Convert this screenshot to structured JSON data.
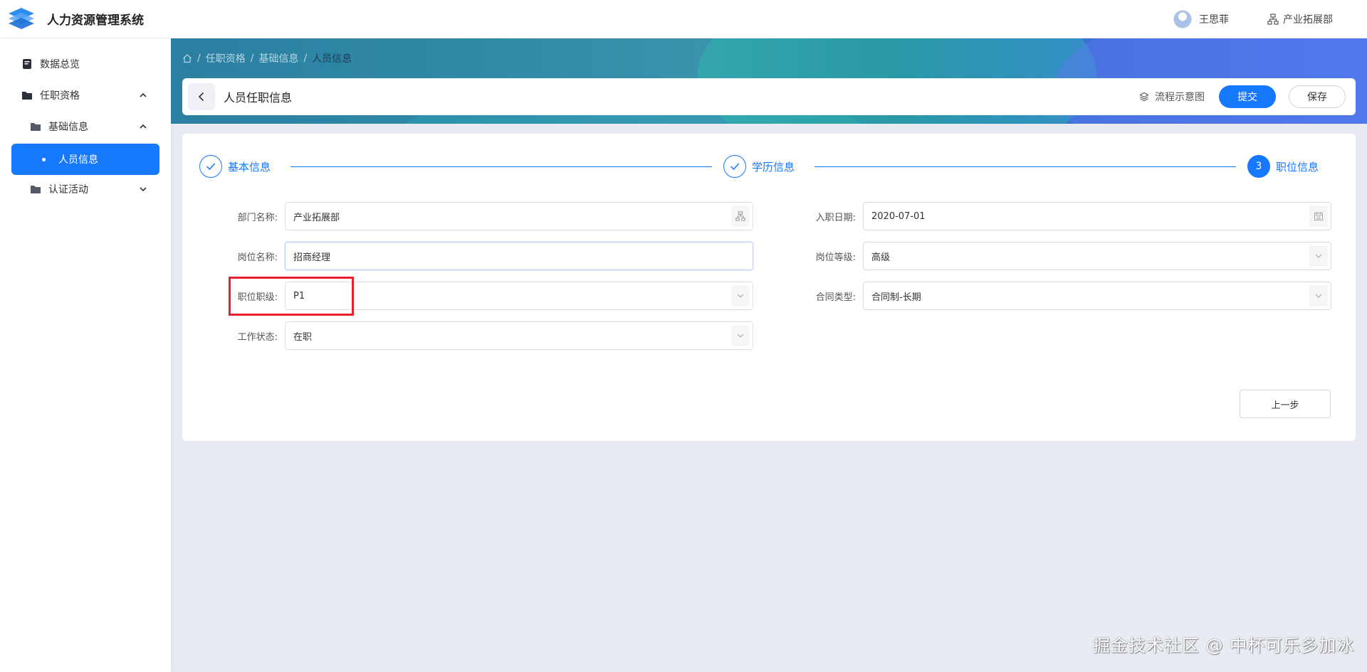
{
  "header": {
    "app_title": "人力资源管理系统",
    "user_name": "王思菲",
    "dept_name": "产业拓展部"
  },
  "sidebar": {
    "items": [
      {
        "label": "数据总览",
        "icon": "dashboard-icon"
      },
      {
        "label": "任职资格",
        "icon": "folder-icon",
        "expanded": true
      },
      {
        "label": "基础信息",
        "icon": "folder-icon",
        "expanded": true
      },
      {
        "label": "人员信息",
        "active": true
      },
      {
        "label": "认证活动",
        "icon": "folder-icon",
        "expanded": false
      }
    ]
  },
  "breadcrumb": [
    "任职资格",
    "基础信息",
    "人员信息"
  ],
  "page": {
    "title": "人员任职信息",
    "flow_label": "流程示意图",
    "submit_label": "提交",
    "save_label": "保存"
  },
  "steps": [
    {
      "label": "基本信息",
      "status": "done"
    },
    {
      "label": "学历信息",
      "status": "done"
    },
    {
      "number": "3",
      "label": "职位信息",
      "status": "current"
    }
  ],
  "form": {
    "left": [
      {
        "label": "部门名称:",
        "value": "产业拓展部",
        "suffix": "org-icon"
      },
      {
        "label": "岗位名称:",
        "value": "招商经理"
      },
      {
        "label": "职位职级:",
        "value": "P1",
        "suffix": "chevron-down-icon"
      },
      {
        "label": "工作状态:",
        "value": "在职",
        "suffix": "chevron-down-icon"
      }
    ],
    "right": [
      {
        "label": "入职日期:",
        "value": "2020-07-01",
        "suffix": "calendar-icon"
      },
      {
        "label": "岗位等级:",
        "value": "高级",
        "suffix": "chevron-down-icon"
      },
      {
        "label": "合同类型:",
        "value": "合同制-长期",
        "suffix": "chevron-down-icon"
      }
    ]
  },
  "prev_label": "上一步",
  "watermark": "掘金技术社区 @ 中杯可乐多加冰",
  "colors": {
    "primary": "#1677ff",
    "highlight": "#e8202a"
  }
}
